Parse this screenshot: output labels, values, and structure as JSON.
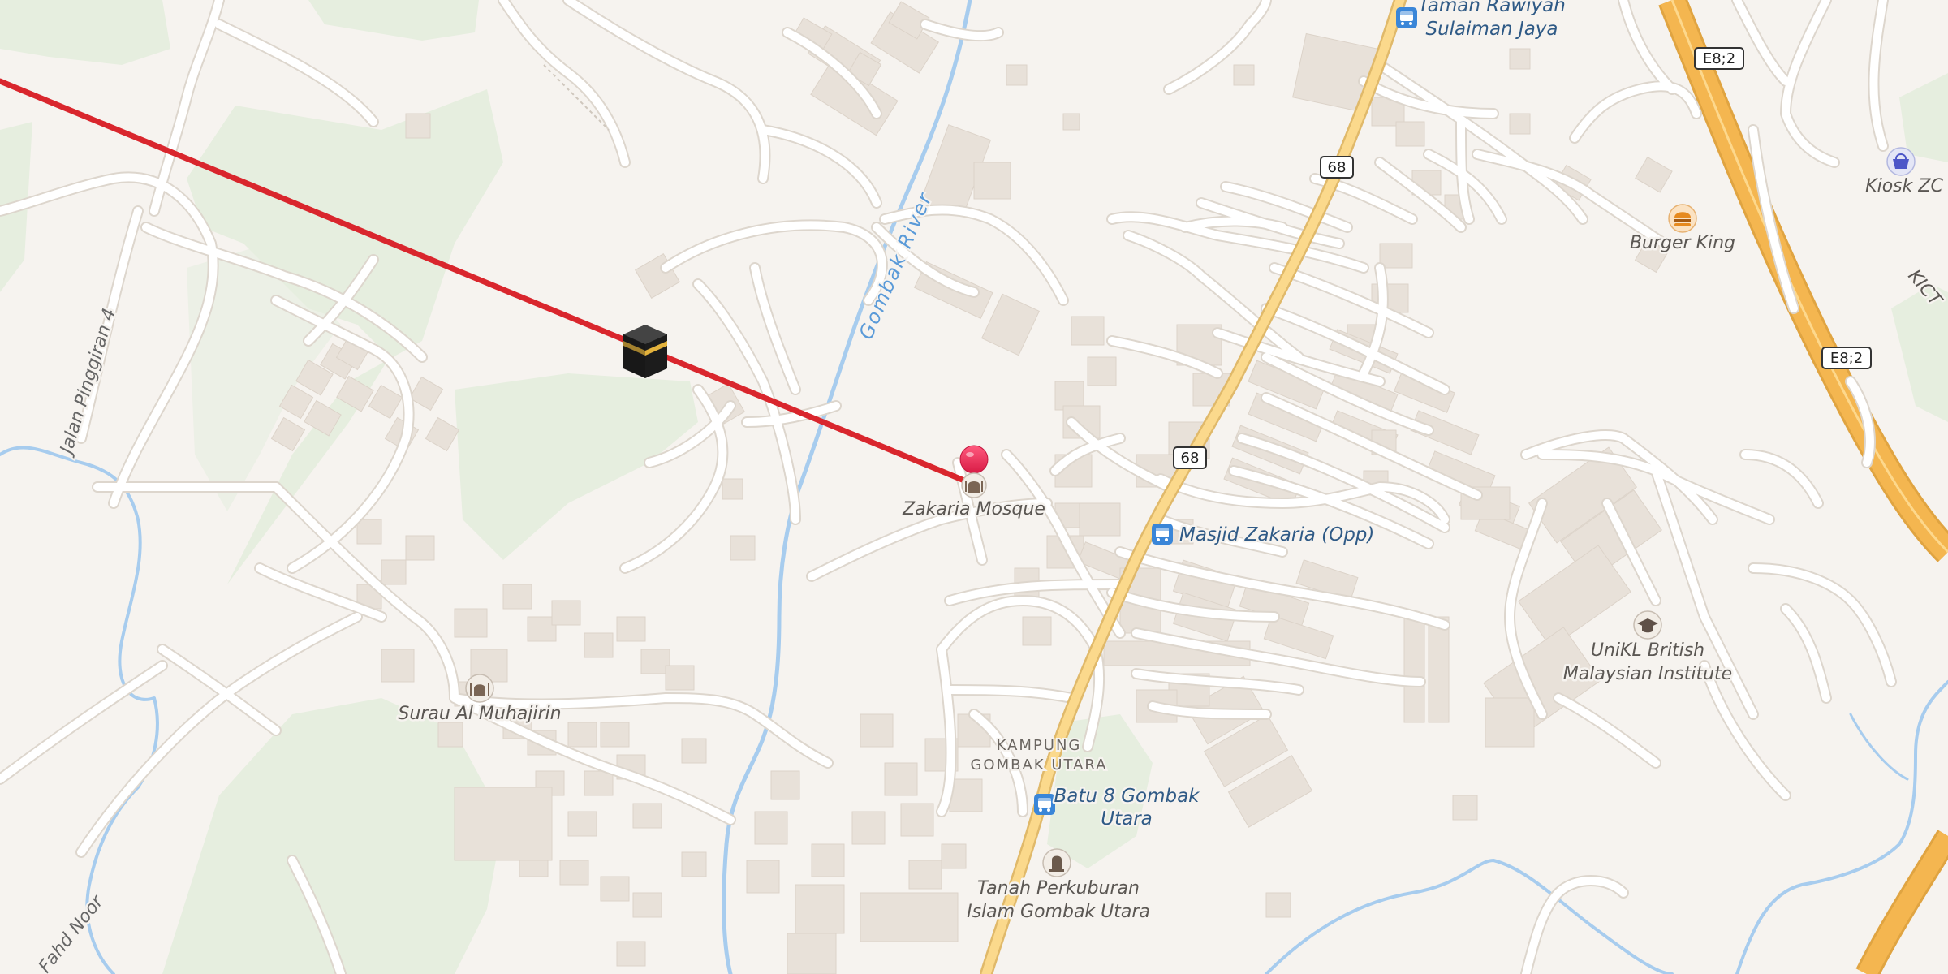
{
  "map": {
    "colors": {
      "land": "#f6f3ef",
      "park": "#e6eedf",
      "water": "#a7ccee",
      "road": "#ffffff",
      "major_road": "#fbd98c",
      "expressway": "#f4b650",
      "route_line": "#d9262d",
      "pin": "#e8244f"
    },
    "places": {
      "mosque": "Zakaria Mosque",
      "surau": "Surau Al Muhajirin",
      "unikl_line1": "UniKL British",
      "unikl_line2": "Malaysian Institute",
      "burger_king": "Burger King",
      "kiosk": "Kiosk ZC",
      "cemetery_line1": "Tanah Perkuburan",
      "cemetery_line2": "Islam Gombak Utara",
      "kampung_line1": "KAMPUNG",
      "kampung_line2": "GOMBAK UTARA",
      "kict": "KICT"
    },
    "bus_stops": {
      "masjid_zakaria": "Masjid Zakaria (Opp)",
      "batu8_line1": "Batu 8 Gombak",
      "batu8_line2": "Utara",
      "taman_line1": "Taman Rawiyah",
      "taman_line2": "Sulaiman Jaya"
    },
    "streets": {
      "jalan_pinggiran": "Jalan Pinggiran 4",
      "fahd_noor": "Fahd Noor"
    },
    "water": {
      "river": "Gombak River"
    },
    "shields": {
      "route68_a": "68",
      "route68_b": "68",
      "e8_a": "E8;2",
      "e8_b": "E8;2"
    },
    "icons": {
      "destination": "kaaba-icon",
      "pin": "map-pin-icon",
      "mosque": "mosque-icon",
      "bus": "bus-stop-icon",
      "school": "graduation-cap-icon",
      "fastfood": "burger-icon",
      "shop": "shopping-basket-icon",
      "cemetery": "cemetery-icon"
    }
  }
}
